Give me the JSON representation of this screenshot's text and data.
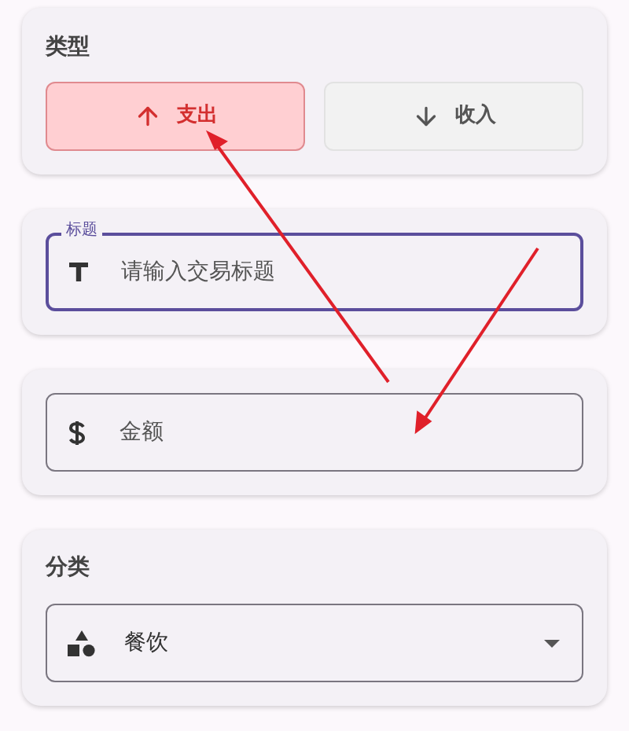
{
  "type_section": {
    "label": "类型",
    "options": [
      {
        "kind": "expense",
        "label": "支出",
        "selected": true
      },
      {
        "kind": "income",
        "label": "收入",
        "selected": false
      }
    ]
  },
  "title_field": {
    "label": "标题",
    "placeholder": "请输入交易标题",
    "focused": true
  },
  "amount_field": {
    "placeholder": "金额",
    "focused": false
  },
  "category_section": {
    "label": "分类",
    "value": "餐饮"
  }
}
